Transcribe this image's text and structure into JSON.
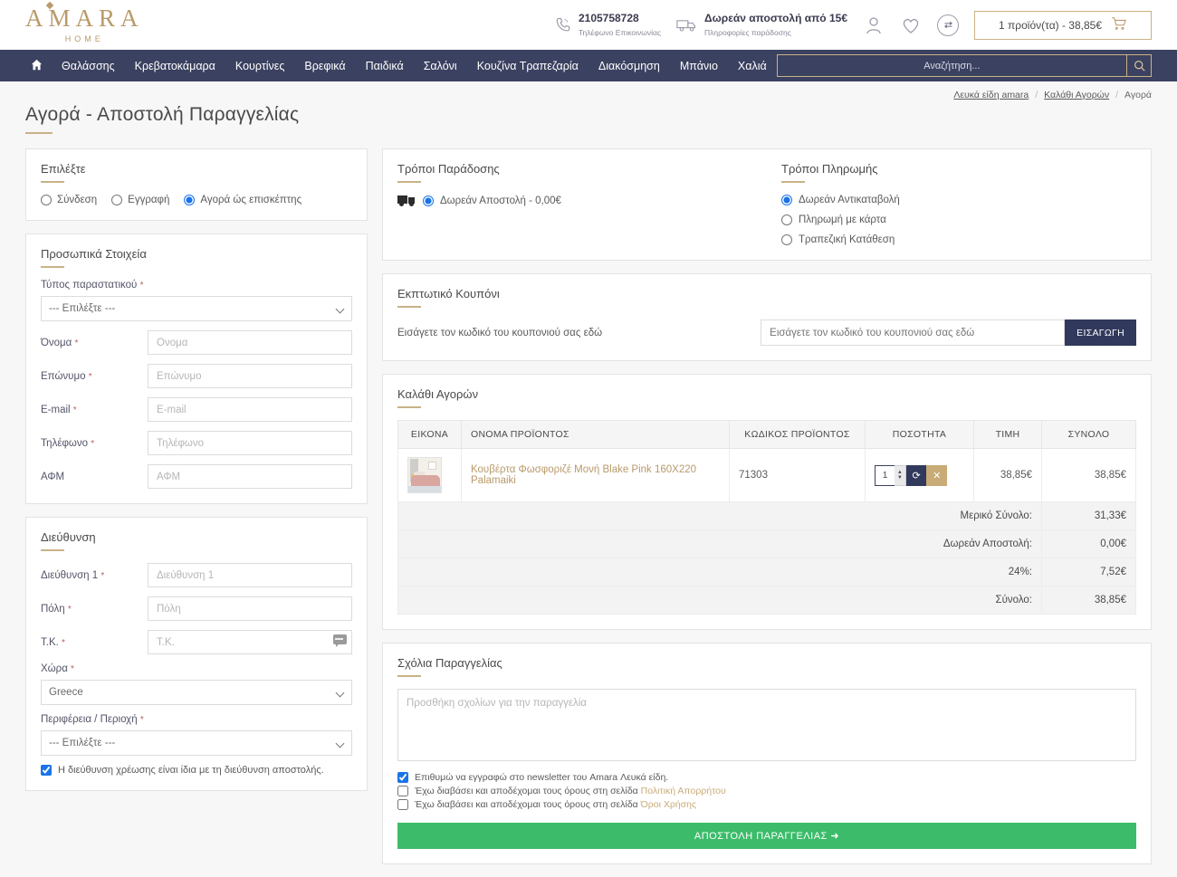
{
  "header": {
    "logo_main": "AMARA",
    "logo_sub": "HOME",
    "phone_number": "2105758728",
    "phone_caption": "Τηλέφωνο Επικοινωνίας",
    "shipping_title": "Δωρεάν αποστολή από 15€",
    "shipping_caption": "Πληροφορίες παράδοσης",
    "cart_label": "1 προϊόν(τα) - 38,85€"
  },
  "nav": {
    "items": [
      "Θαλάσσης",
      "Κρεβατοκάμαρα",
      "Κουρτίνες",
      "Βρεφικά",
      "Παιδικά",
      "Σαλόνι",
      "Κουζίνα Τραπεζαρία",
      "Διακόσμηση",
      "Μπάνιο",
      "Χαλιά"
    ],
    "search_placeholder": "Αναζήτηση..."
  },
  "breadcrumb": {
    "items": [
      "Λευκά είδη amara",
      "Καλάθι Αγορών",
      "Αγορά"
    ],
    "separator": "/"
  },
  "page": {
    "title": "Αγορά - Αποστολή Παραγγελίας"
  },
  "choose": {
    "title": "Επιλέξτε",
    "options": [
      "Σύνδεση",
      "Εγγραφή",
      "Αγορά ώς επισκέπτης"
    ],
    "selected": "Αγορά ώς επισκέπτης"
  },
  "personal": {
    "title": "Προσωπικά Στοιχεία",
    "doc_type_label": "Τύπος παραστατικού",
    "doc_type_value": "--- Επιλέξτε ---",
    "fields": [
      {
        "label": "Όνομα",
        "placeholder": "Ονομα",
        "required": true
      },
      {
        "label": "Επώνυμο",
        "placeholder": "Επώνυμο",
        "required": true
      },
      {
        "label": "E-mail",
        "placeholder": "E-mail",
        "required": true
      },
      {
        "label": "Τηλέφωνο",
        "placeholder": "Τηλέφωνο",
        "required": true
      },
      {
        "label": "ΑΦΜ",
        "placeholder": "ΑΦΜ",
        "required": false
      }
    ]
  },
  "address": {
    "title": "Διεύθυνση",
    "fields": [
      {
        "label": "Διεύθυνση 1",
        "placeholder": "Διεύθυνση 1",
        "required": true
      },
      {
        "label": "Πόλη",
        "placeholder": "Πόλη",
        "required": true
      },
      {
        "label": "Τ.Κ.",
        "placeholder": "Τ.Κ.",
        "required": true
      }
    ],
    "country_label": "Χώρα",
    "country_value": "Greece",
    "region_label": "Περιφέρεια / Περιοχή",
    "region_value": "--- Επιλέξτε ---",
    "same_address_label": "Η διεύθυνση χρέωσης είναι ίδια με τη διεύθυνση αποστολής.",
    "same_address_checked": true
  },
  "delivery": {
    "title": "Τρόποι Παράδοσης",
    "options": [
      "Δωρεάν Αποστολή - 0,00€"
    ],
    "selected": "Δωρεάν Αποστολή - 0,00€"
  },
  "payment": {
    "title": "Τρόποι Πληρωμής",
    "options": [
      "Δωρεάν Αντικαταβολή",
      "Πληρωμή με κάρτα",
      "Τραπεζική Κατάθεση"
    ],
    "selected": "Δωρεάν Αντικαταβολή"
  },
  "coupon": {
    "title": "Εκπτωτικό Κουπόνι",
    "label": "Εισάγετε τον κωδικό του κουπονιού σας εδώ",
    "placeholder": "Εισάγετε τον κωδικό του κουπονιού σας εδώ",
    "button": "ΕΙΣΑΓΩΓΗ"
  },
  "cart": {
    "title": "Καλάθι Αγορών",
    "columns": [
      "ΕΙΚΟΝΑ",
      "ΟΝΟΜΑ ΠΡΟΪΟΝΤΟΣ",
      "ΚΩΔΙΚΟΣ ΠΡΟΪΟΝΤΟΣ",
      "ΠΟΣΟΤΗΤΑ",
      "ΤΙΜΗ",
      "ΣΥΝΟΛΟ"
    ],
    "rows": [
      {
        "name": "Κουβέρτα Φωσφοριζέ Μονή Blake Pink 160X220 Palamaiki",
        "code": "71303",
        "qty": "1",
        "price": "38,85€",
        "total": "38,85€"
      }
    ],
    "totals": [
      {
        "label": "Μερικό Σύνολο:",
        "value": "31,33€"
      },
      {
        "label": "Δωρεάν Αποστολή:",
        "value": "0,00€"
      },
      {
        "label": "24%:",
        "value": "7,52€"
      },
      {
        "label": "Σύνολο:",
        "value": "38,85€"
      }
    ]
  },
  "comments": {
    "title": "Σχόλια Παραγγελίας",
    "placeholder": "Προσθήκη σχολίων για την παραγγελία",
    "newsletter_label": "Επιθυμώ να εγγραφώ στο newsletter του Amara Λευκά είδη.",
    "newsletter_checked": true,
    "terms_prefix_1": "Έχω διαβάσει και αποδέχομαι τους όρους στη σελίδα",
    "terms_link_1": "Πολιτική Απορρήτου",
    "terms_prefix_2": "Έχω διαβάσει και αποδέχομαι τους όρους στη σελίδα",
    "terms_link_2": "Όροι Χρήσης",
    "submit_label": "ΑΠΟΣΤΟΛΗ ΠΑΡΑΓΓΕΛΙΑΣ  ➜"
  },
  "colors": {
    "gold": "#c9b286",
    "navy": "#3b4160",
    "green": "#3cbc6a",
    "accent_text": "#b99a6b"
  }
}
